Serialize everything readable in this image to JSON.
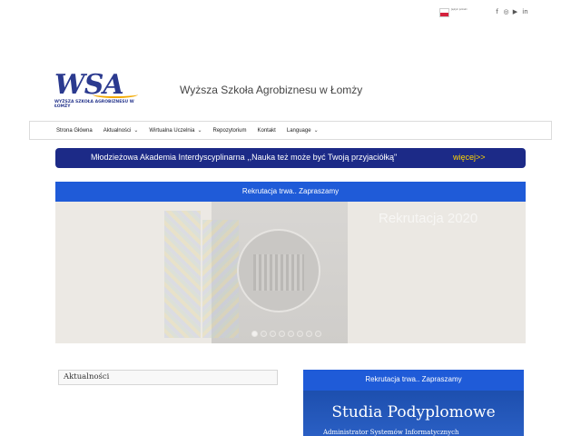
{
  "topbar": {
    "flag_label": "Język polski",
    "social_icons": [
      "facebook-icon",
      "instagram-icon",
      "youtube-icon",
      "linkedin-icon"
    ],
    "social_glyphs": [
      "f",
      "◎",
      "▶",
      "in"
    ]
  },
  "header": {
    "logo_text": "WSA",
    "logo_subtitle": "WYŻSZA SZKOŁA AGROBIZNESU W ŁOMŻY",
    "site_title": "Wyższa Szkoła Agrobiznesu w Łomży"
  },
  "nav": {
    "items": [
      {
        "label": "Strona Główna",
        "dropdown": false
      },
      {
        "label": "Aktualności",
        "dropdown": true
      },
      {
        "label": "Wirtualna Uczelnia",
        "dropdown": true
      },
      {
        "label": "Repozytorium",
        "dropdown": false
      },
      {
        "label": "Kontakt",
        "dropdown": false
      },
      {
        "label": "Language",
        "dropdown": true
      }
    ]
  },
  "announcement": {
    "text": "Młodzieżowa Akademia Interdyscyplinarna ,,Nauka też może być Twoją przyjaciółką\"",
    "more_link": "więcej>>"
  },
  "banner": {
    "text": "Rekrutacja trwa.. Zapraszamy"
  },
  "slider": {
    "slide_title": "Rekrutacja 2020",
    "dot_count": 8,
    "active_dot": 0
  },
  "news": {
    "title": "Aktualności"
  },
  "sidebar": {
    "banner_text": "Rekrutacja trwa.. Zapraszamy",
    "promo_title": "Studia Podyplomowe",
    "promo_subtitle": "Administrator Systemów Informatycznych"
  },
  "colors": {
    "navy": "#1c2a87",
    "blue": "#1f5bd8",
    "accent_yellow": "#ffd400"
  }
}
